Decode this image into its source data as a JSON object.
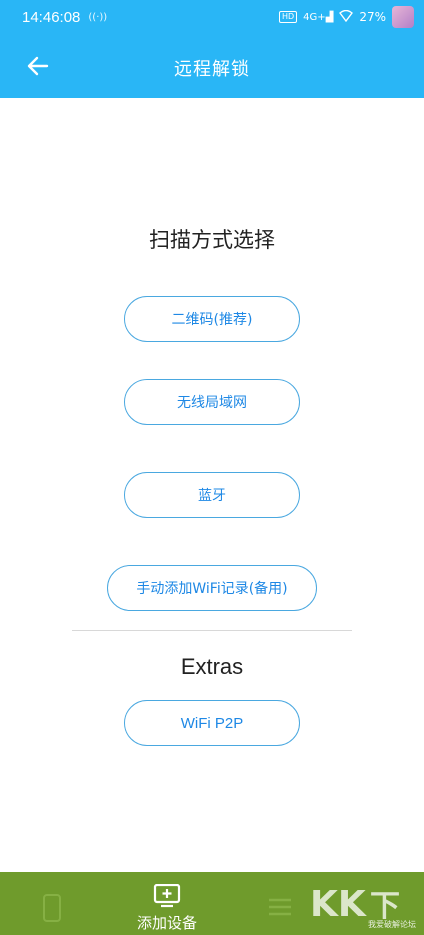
{
  "status_bar": {
    "time": "14:46:08",
    "nfc": "((·))",
    "hd": "HD",
    "network": "4G+",
    "battery": "27%"
  },
  "app_bar": {
    "title": "远程解锁"
  },
  "main": {
    "scan_title": "扫描方式选择",
    "options": [
      {
        "label": "二维码(推荐)"
      },
      {
        "label": "无线局域网"
      },
      {
        "label": "蓝牙"
      },
      {
        "label": "手动添加WiFi记录(备用)"
      }
    ],
    "extras_title": "Extras",
    "extras_options": [
      {
        "label": "WiFi P2P"
      }
    ]
  },
  "bottom_nav": {
    "items": [
      {
        "label": ""
      },
      {
        "label": "添加设备"
      },
      {
        "label": ""
      }
    ]
  },
  "watermark": {
    "text": "我爱破解论坛"
  },
  "colors": {
    "primary": "#29b6f6",
    "button_border": "#4aa8e0",
    "button_text": "#1e88e5",
    "bottom_bar": "#6f9b2c"
  }
}
